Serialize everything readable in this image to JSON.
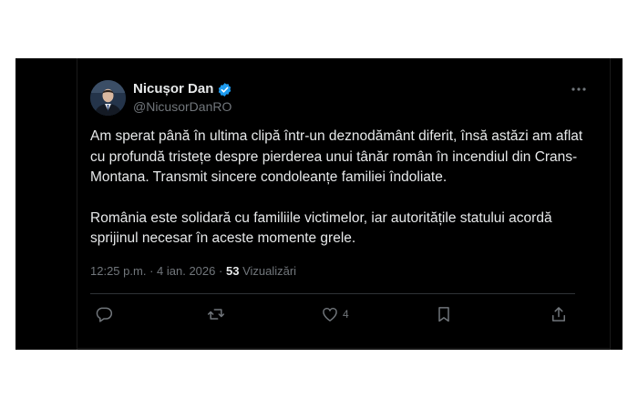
{
  "colors": {
    "background": "#000000",
    "text": "#e7e9ea",
    "muted": "#71767b",
    "verified": "#1d9bf0",
    "divider": "#2f3336"
  },
  "author": {
    "name": "Nicușor Dan",
    "handle": "@NicusorDanRO",
    "verified_icon": "verified-badge-icon",
    "avatar_icon": "avatar"
  },
  "tweet": {
    "paragraph_1": "Am sperat până în ultima clipă într-un deznodământ diferit, însă astăzi am aflat cu profundă tristețe despre pierderea unui tânăr român în incendiul din Crans-Montana. Transmit sincere condoleanțe familiei îndoliate.",
    "paragraph_2": "România este solidară cu familiile victimelor, iar autoritățile statului acordă sprijinul necesar în aceste momente grele."
  },
  "meta": {
    "time": "12:25 p.m.",
    "separator": "·",
    "date": "4 ian. 2026",
    "separator2": "·",
    "views_count": "53",
    "views_label": "Vizualizări"
  },
  "actions": {
    "reply_icon": "reply-icon",
    "retweet_icon": "retweet-icon",
    "like_icon": "heart-icon",
    "like_count": "4",
    "bookmark_icon": "bookmark-icon",
    "share_icon": "share-icon"
  },
  "menu": {
    "more_icon": "more-icon"
  }
}
